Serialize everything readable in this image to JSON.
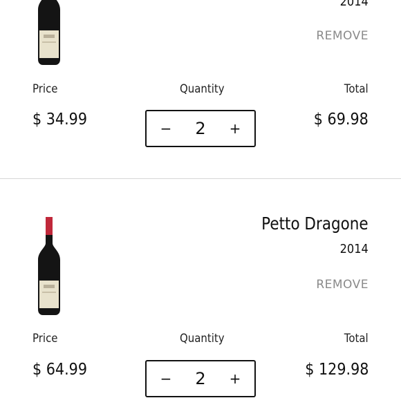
{
  "items": [
    {
      "name": "",
      "vintage": "2014",
      "remove_label": "REMOVE",
      "price_label": "Price",
      "quantity_label": "Quantity",
      "total_label": "Total",
      "price": "$ 34.99",
      "quantity": "2",
      "total": "$ 69.98",
      "decrement_symbol": "−",
      "increment_symbol": "+",
      "capsule_color": "#111111"
    },
    {
      "name": "Petto Dragone",
      "vintage": "2014",
      "remove_label": "REMOVE",
      "price_label": "Price",
      "quantity_label": "Quantity",
      "total_label": "Total",
      "price": "$ 64.99",
      "quantity": "2",
      "total": "$ 129.98",
      "decrement_symbol": "−",
      "increment_symbol": "+",
      "capsule_color": "#c0283a"
    }
  ],
  "colors": {
    "text": "#111111",
    "muted": "#8a8a8a",
    "divider": "#d6d6d6",
    "bottle_glass": "#141414",
    "bottle_label": "#e8e2cc"
  }
}
